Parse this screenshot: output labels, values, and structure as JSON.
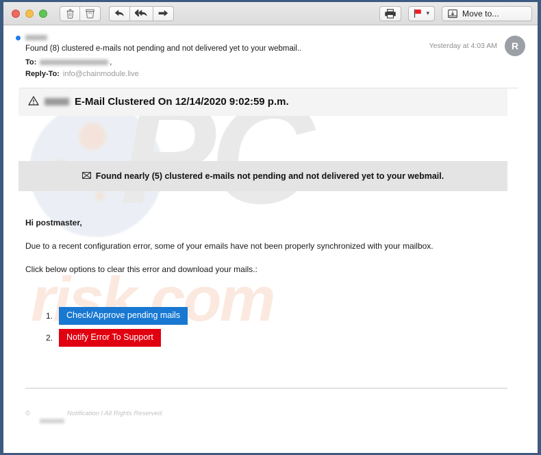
{
  "window": {
    "frame_color": "#3d5a80"
  },
  "toolbar": {
    "traffic_lights": [
      {
        "name": "close",
        "color": "#ed6a5e"
      },
      {
        "name": "minimize",
        "color": "#f5bf4f"
      },
      {
        "name": "zoom",
        "color": "#61c555"
      }
    ],
    "buttons": [
      {
        "icon": "trash-icon",
        "label": ""
      },
      {
        "icon": "junk-bin-icon",
        "label": ""
      },
      {
        "icon": "reply-icon",
        "label": ""
      },
      {
        "icon": "reply-all-icon",
        "label": ""
      },
      {
        "icon": "forward-icon",
        "label": ""
      },
      {
        "icon": "print-icon",
        "label": ""
      },
      {
        "icon": "flag-icon",
        "label": ""
      },
      {
        "icon": "move-to-icon",
        "label": "Move to..."
      }
    ],
    "move_to_label": "Move to...",
    "flag_color": "#ec2024",
    "flag_chevron": "⌄"
  },
  "message": {
    "unread": true,
    "sender_redacted": true,
    "subject": "Found (8) clustered e-mails not pending and not delivered yet to your webmail..",
    "to_label": "To:",
    "to_value_redacted": true,
    "to_comma": ",",
    "reply_to_label": "Reply-To:",
    "reply_to_value": "info@chainmodule.live",
    "date": "Yesterday at 4:03 AM",
    "avatar_initial": "R",
    "avatar_color": "#9b9fa6"
  },
  "body": {
    "banner_title": {
      "icon": "warning-triangle-icon",
      "redacted_prefix": true,
      "text": "E-Mail Clustered On 12/14/2020 9:02:59 p.m.",
      "background": "#f4f4f4"
    },
    "banner_sub": {
      "icon": "envelope-icon",
      "text": "Found nearly (5) clustered e-mails not pending and not delivered yet to your webmail.",
      "background": "#e4e4e4"
    },
    "greeting": "Hi postmaster,",
    "paragraph_1": "Due to a recent configuration error, some of your emails have not been properly synchronized with your mailbox.",
    "paragraph_2": "Click below options to clear this error and download your mails.:",
    "options": [
      {
        "number": "1.",
        "label": "Check/Approve pending mails",
        "color": "#1878d2"
      },
      {
        "number": "2.",
        "label": "Notify Error To Support",
        "color": "#e00010"
      }
    ],
    "footer": {
      "copyright_symbol": "©",
      "redacted_name": true,
      "text": "Notification I All Rights Reserved."
    },
    "watermarks": {
      "primary": "PC",
      "secondary": "risk.com",
      "primary_color": "#e9e9e9",
      "secondary_color": "#fbe9e0"
    }
  }
}
